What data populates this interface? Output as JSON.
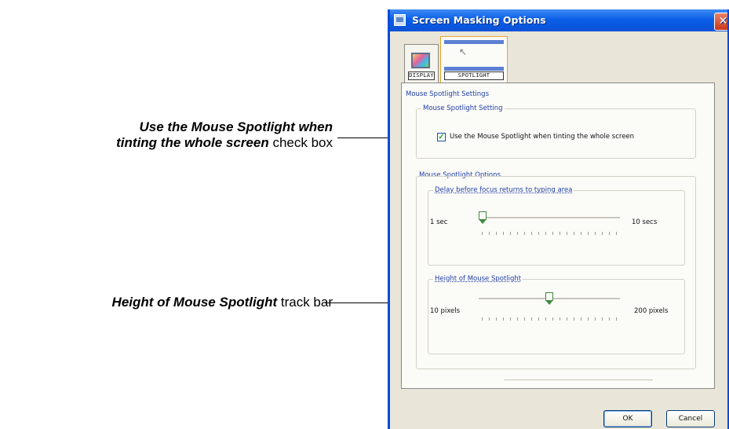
{
  "callouts": {
    "checkbox_bold_line1": "Use the Mouse Spotlight when",
    "checkbox_bold_line2": "tinting the whole screen",
    "checkbox_suffix": " check box",
    "trackbar_bold": "Height of Mouse Spotlight",
    "trackbar_suffix": " track bar"
  },
  "window": {
    "title": "Screen Masking Options",
    "close_symbol": "✕",
    "title_icon": "app-window-icon",
    "colors": {
      "titlebar": "#0a5ee7",
      "face": "#e9e6d9",
      "accent": "#1f3ea5"
    }
  },
  "tabs": [
    {
      "label": "DISPLAY",
      "icon": "display-icon",
      "active": false
    },
    {
      "label": "SPOTLIGHT",
      "icon": "spotlight-icon",
      "active": true
    }
  ],
  "panel": {
    "title": "Mouse Spotlight Settings",
    "setting_group": {
      "title": "Mouse Spotlight Setting",
      "checkbox_label": "Use the Mouse Spotlight when tinting the whole screen",
      "checked": true
    },
    "options_group": {
      "title": "Mouse Spotlight Options",
      "delay": {
        "title": "Delay before focus returns to typing area",
        "min_label": "1 sec",
        "max_label": "10 secs",
        "value_fraction": 0.0
      },
      "height": {
        "title": "Height of Mouse Spotlight",
        "min_label": "10 pixels",
        "max_label": "200 pixels",
        "value_fraction": 0.5
      }
    }
  },
  "buttons": {
    "ok": "OK",
    "cancel": "Cancel"
  }
}
